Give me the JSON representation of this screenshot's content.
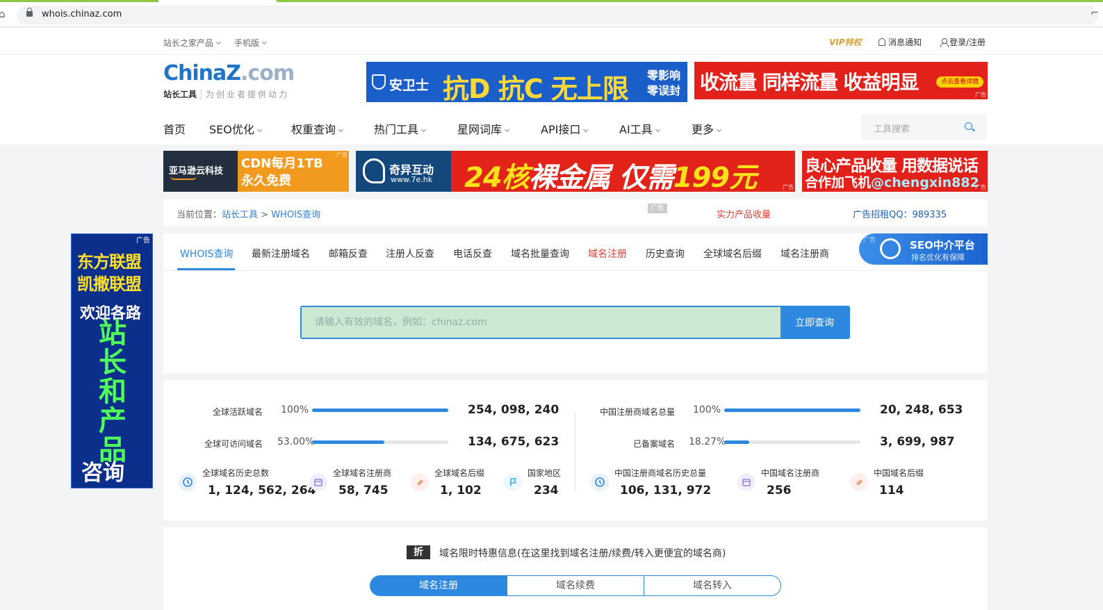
{
  "browser": {
    "url": "whois.chinaz.com"
  },
  "topbar": {
    "products": "站长之家产品",
    "mobile": "手机版",
    "vip": "VIP特权",
    "notify": "消息通知",
    "login": "登录/注册"
  },
  "logo": {
    "part1": "China",
    "part2": "Z",
    "part3": ".com",
    "tag": "站长工具",
    "slogan": "为创业者提供动力"
  },
  "ads": {
    "ad1_brand": "安卫士",
    "ad1_big": "抗D 抗C 无上限",
    "ad1_z1": "零影响",
    "ad1_z2": "零误封",
    "ad2_big": "收流量 同样流量 收益明显",
    "ad2_cta": "点击查看详情",
    "tag": "广告",
    "b1_left": "亚马逊云科技",
    "b1_l1": "CDN每月1TB",
    "b1_l2": "永久免费",
    "b2_name": "奇异互动",
    "b2_url": "www.7e.hk",
    "b2_big1": "24核",
    "b2_big2": "裸金属",
    "b2_big3": " 仅需",
    "b2_big4": "199元",
    "b3_l1": "良心产品收量 用数据说话",
    "b3_l2a": "合作加飞机",
    "b3_l2b": "@chengxin882",
    "vad_l1": "东方联盟",
    "vad_l2": "凯撒联盟",
    "vad_l3": "欢迎各路",
    "vad_vert": "站长和产品",
    "vad_l4": "咨询"
  },
  "nav": [
    "首页",
    "SEO优化",
    "权重查询",
    "热门工具",
    "星网词库",
    "API接口",
    "AI工具",
    "更多"
  ],
  "search": {
    "placeholder": "工具搜索"
  },
  "breadcrumb": {
    "label": "当前位置：",
    "home": "站长工具",
    "sep": " > ",
    "current": "WHOIS查询",
    "ad": "广告",
    "red": "实力产品收量",
    "blue": "广告招租QQ：989335"
  },
  "tabs": [
    "WHOIS查询",
    "最新注册域名",
    "邮箱反查",
    "注册人反查",
    "电话反查",
    "域名批量查询",
    "域名注册",
    "历史查询",
    "全球域名后缀",
    "域名注册商"
  ],
  "seo_badge": {
    "title": "SEO中介平台",
    "sub": "排名优化有保障",
    "tag": "广告"
  },
  "query": {
    "placeholder": "请输入有效的域名，例如：chinaz.com",
    "button": "立即查询"
  },
  "stats": {
    "rows": [
      {
        "label": "全球活跃域名",
        "pct": "100%",
        "fill": 100,
        "num": "254, 098, 240"
      },
      {
        "label": "全球可访问域名",
        "pct": "53.00%",
        "fill": 53,
        "num": "134, 675, 623"
      },
      {
        "label": "中国注册商域名总量",
        "pct": "100%",
        "fill": 100,
        "num": "20, 248, 653"
      },
      {
        "label": "已备案域名",
        "pct": "18.27%",
        "fill": 18.27,
        "num": "3, 699, 987"
      }
    ],
    "minis": [
      {
        "label": "全球域名历史总数",
        "num": "1, 124, 562, 264",
        "icon": "history-icon"
      },
      {
        "label": "全球域名注册商",
        "num": "58, 745",
        "icon": "store-icon"
      },
      {
        "label": "全球域名后缀",
        "num": "1, 102",
        "icon": "tag-icon"
      },
      {
        "label": "国家地区",
        "num": "234",
        "icon": "flag-icon"
      },
      {
        "label": "中国注册商域名历史总量",
        "num": "106, 131, 972",
        "icon": "history-icon"
      },
      {
        "label": "中国域名注册商",
        "num": "256",
        "icon": "store-icon"
      },
      {
        "label": "中国域名后缀",
        "num": "114",
        "icon": "tag-icon"
      }
    ]
  },
  "discount": {
    "badge": "折",
    "text": "域名限时特惠信息(在这里找到域名注册/续费/转入更便宜的域名商)",
    "segments": [
      "域名注册",
      "域名续费",
      "域名转入"
    ]
  }
}
